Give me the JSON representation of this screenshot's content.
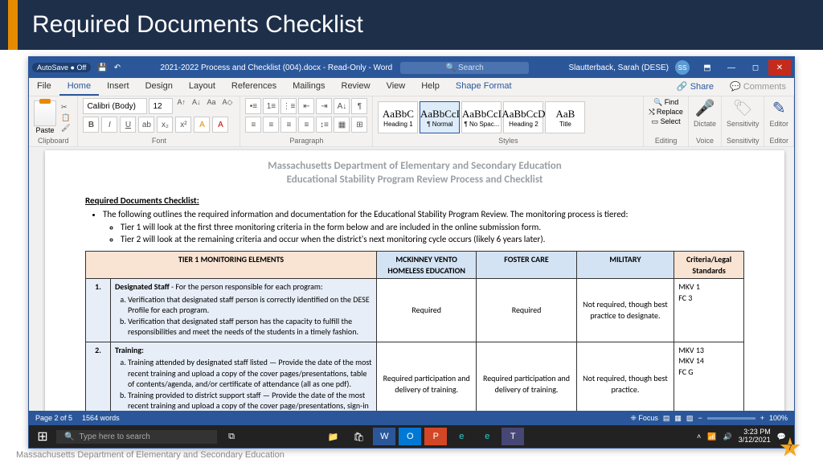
{
  "slide": {
    "title": "Required Documents Checklist"
  },
  "titlebar": {
    "autosave": "AutoSave ● Off",
    "docname": "2021-2022 Process and Checklist (004).docx - Read-Only - Word",
    "search_placeholder": "Search",
    "user": "Slautterback, Sarah (DESE)"
  },
  "menu": {
    "items": [
      "File",
      "Home",
      "Insert",
      "Design",
      "Layout",
      "References",
      "Mailings",
      "Review",
      "View",
      "Help",
      "Shape Format"
    ],
    "active": "Home",
    "share": "Share",
    "comments": "Comments"
  },
  "ribbon": {
    "clipboard": "Clipboard",
    "font": "Font",
    "font_name": "Calibri (Body)",
    "font_size": "12",
    "paragraph": "Paragraph",
    "styles": "Styles",
    "style_items": [
      {
        "preview": "AaBbC",
        "label": "Heading 1"
      },
      {
        "preview": "AaBbCcI",
        "label": "¶ Normal"
      },
      {
        "preview": "AaBbCcI",
        "label": "¶ No Spac..."
      },
      {
        "preview": "AaBbCcD",
        "label": "Heading 2"
      },
      {
        "preview": "AaB",
        "label": "Title"
      }
    ],
    "editing": {
      "label": "Editing",
      "find": "Find",
      "replace": "Replace",
      "select": "Select"
    },
    "voice": "Voice",
    "dictate": "Dictate",
    "sensitivity": "Sensitivity",
    "editor": "Editor"
  },
  "document": {
    "title_line1": "Massachusetts Department of Elementary and Secondary Education",
    "title_line2": "Educational Stability Program Review Process and Checklist",
    "section_heading": "Required Documents Checklist:",
    "intro": "The following outlines the required information and documentation for the Educational Stability Program Review.  The monitoring process is tiered:",
    "tier1_bullet": "Tier 1 will look at the first three monitoring criteria in the form below and are included in the online submission form.",
    "tier2_bullet": "Tier 2 will look at the remaining criteria and occur when the district's next monitoring cycle occurs (likely 6 years later).",
    "table": {
      "header_main": "TIER 1 MONITORING ELEMENTS",
      "cols": [
        "MCKINNEY VENTO HOMELESS EDUCATION",
        "FOSTER CARE",
        "MILITARY",
        "Criteria/Legal Standards"
      ],
      "rows": [
        {
          "num": "1.",
          "title": "Designated Staff",
          "desc": "- For the person responsible for each program:",
          "items": [
            "Verification that designated staff person is correctly identified on the DESE Profile for each program.",
            "Verification that designated staff person has the capacity to fulfill the responsibilities and meet the needs of the students in a timely fashion."
          ],
          "cells": [
            "Required",
            "Required",
            "Not required, though best practice to designate.",
            "MKV 1\nFC 3"
          ]
        },
        {
          "num": "2.",
          "title": "Training:",
          "desc": "",
          "items": [
            "Training attended by designated staff listed — Provide the date of the most recent training and upload a copy of the cover pages/presentations, table of contents/agenda, and/or certificate of attendance (all as one pdf).",
            "Training provided to district support staff — Provide the date of the most recent training and upload a copy of the cover page/presentations, sign-in sheets, and agenda (all as one pdf)."
          ],
          "cells": [
            "Required participation and delivery of training.",
            "Required participation and delivery of training.",
            "Not required, though best practice.",
            "MKV 13\nMKV 14\nFC G"
          ]
        }
      ]
    }
  },
  "statusbar": {
    "page": "Page 2 of 5",
    "words": "1564 words",
    "focus": "Focus",
    "zoom": "100%"
  },
  "taskbar": {
    "search": "Type here to search",
    "time": "3:23 PM",
    "date": "3/12/2021"
  },
  "footer": {
    "org": "Massachusetts Department of Elementary and Secondary Education",
    "page": "7"
  }
}
